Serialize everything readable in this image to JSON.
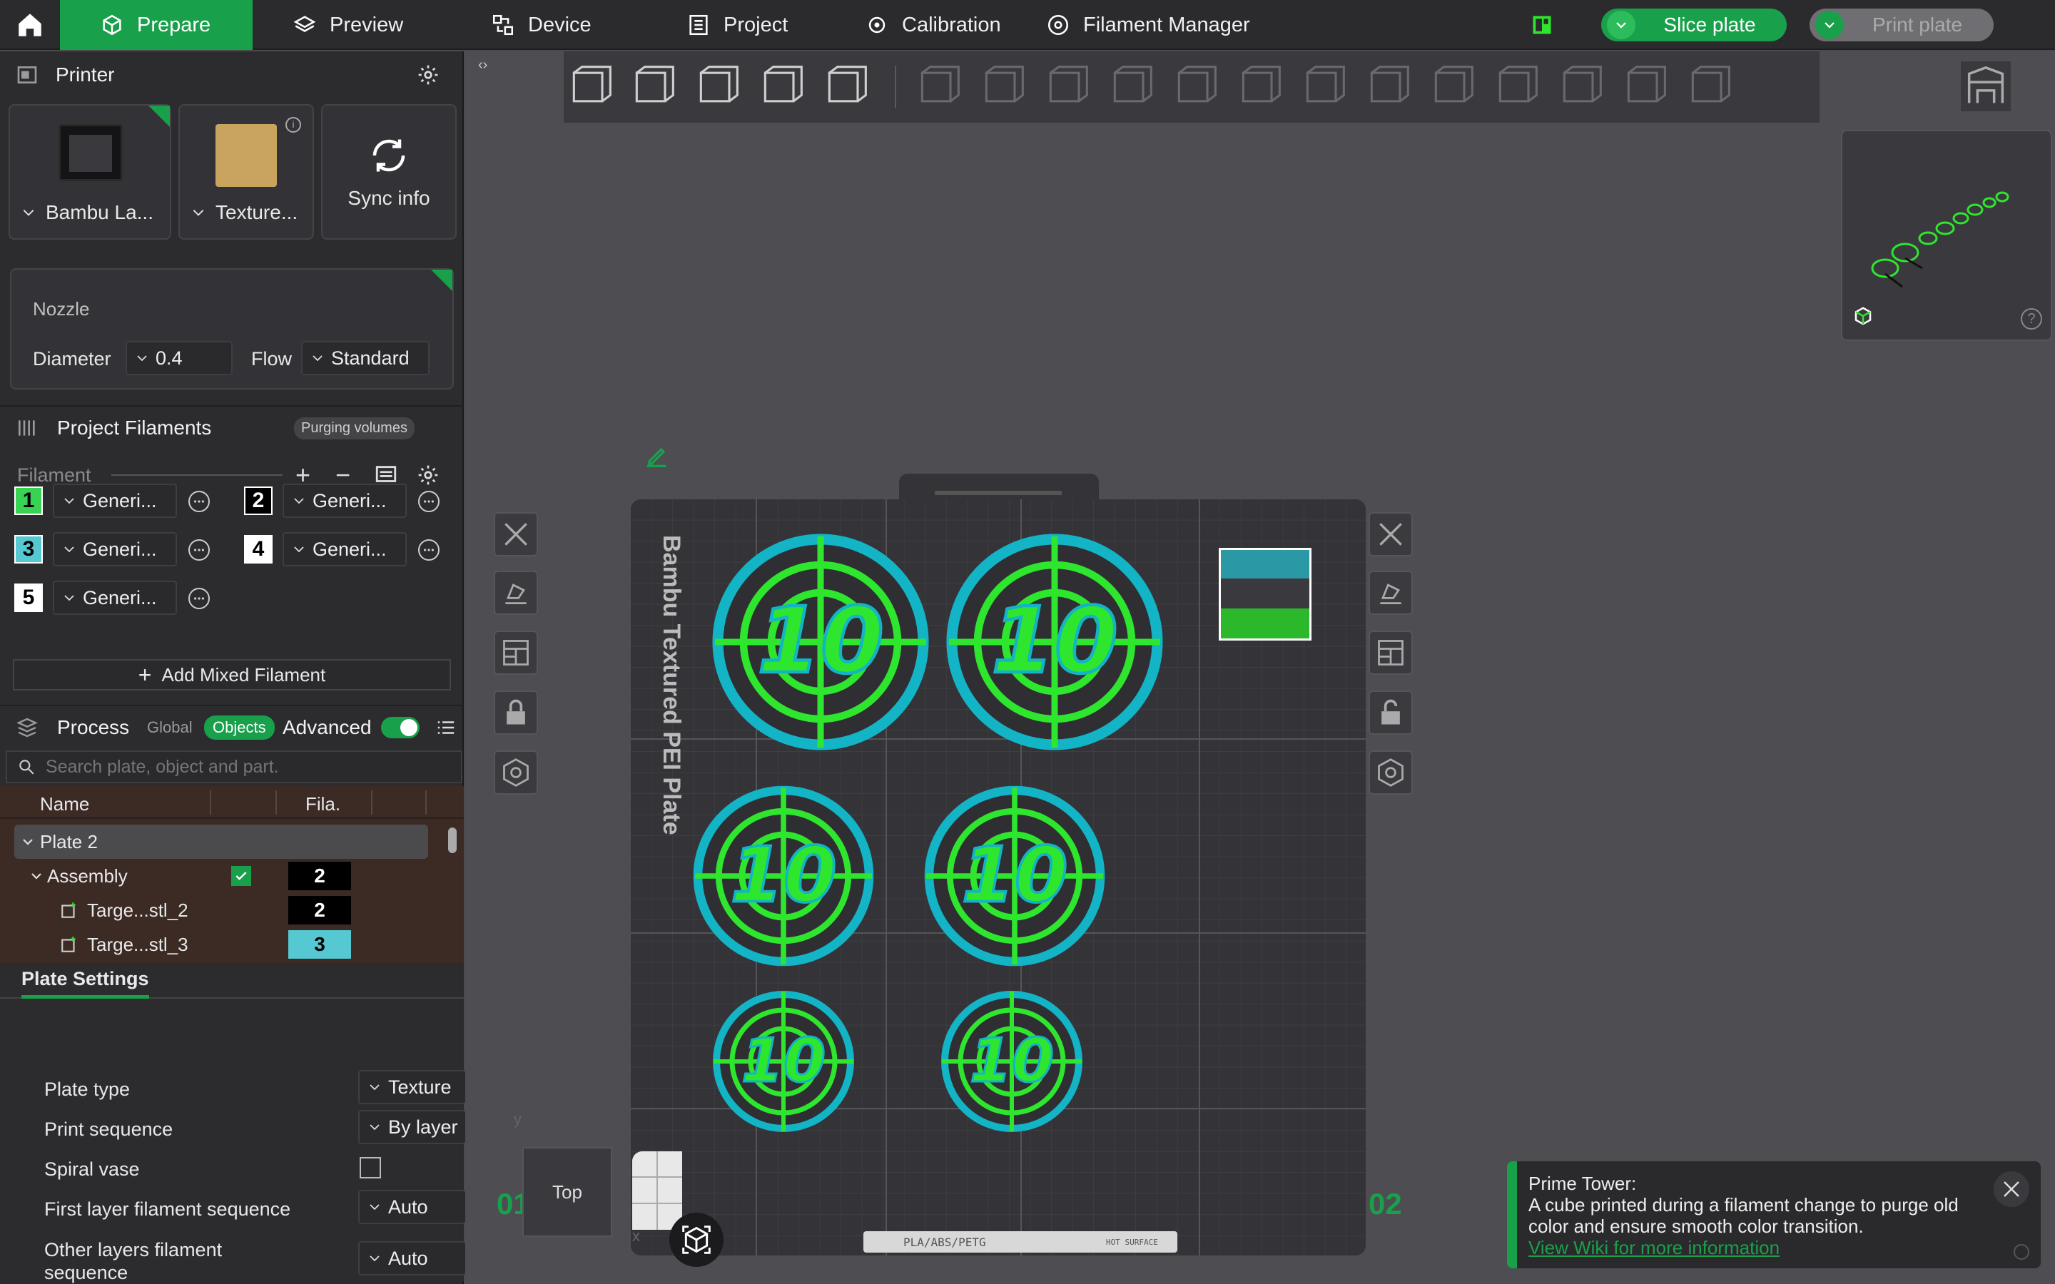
{
  "topbar": {
    "tabs": [
      {
        "label": "Prepare",
        "icon": "cube-icon"
      },
      {
        "label": "Preview",
        "icon": "layers-icon"
      },
      {
        "label": "Device",
        "icon": "device-icon"
      },
      {
        "label": "Project",
        "icon": "project-icon"
      },
      {
        "label": "Calibration",
        "icon": "calibration-icon"
      },
      {
        "label": "Filament Manager",
        "icon": "filament-manager-icon"
      }
    ],
    "slice_label": "Slice plate",
    "print_label": "Print plate"
  },
  "printer": {
    "title": "Printer",
    "printer_name": "Bambu La...",
    "plate_name": "Texture...",
    "sync_label": "Sync info",
    "nozzle_title": "Nozzle",
    "diameter_label": "Diameter",
    "diameter_value": "0.4",
    "flow_label": "Flow",
    "flow_value": "Standard"
  },
  "filaments": {
    "title": "Project Filaments",
    "purge_label": "Purging volumes",
    "filament_label": "Filament",
    "items": [
      {
        "num": "1",
        "name": "Generi...",
        "color": "#39d353",
        "text": "#000"
      },
      {
        "num": "2",
        "name": "Generi...",
        "color": "#000000",
        "text": "#fff"
      },
      {
        "num": "3",
        "name": "Generi...",
        "color": "#55c8d2",
        "text": "#000"
      },
      {
        "num": "4",
        "name": "Generi...",
        "color": "#ffffff",
        "text": "#000"
      },
      {
        "num": "5",
        "name": "Generi...",
        "color": "#ffffff",
        "text": "#000"
      }
    ],
    "add_mixed": "Add Mixed Filament"
  },
  "process": {
    "title": "Process",
    "global_label": "Global",
    "objects_label": "Objects",
    "advanced_label": "Advanced",
    "search_placeholder": "Search plate, object and part.",
    "col_name": "Name",
    "col_fila": "Fila.",
    "tree": [
      {
        "label": "Plate 2",
        "level": 0
      },
      {
        "label": "Assembly",
        "level": 1,
        "fila": "2"
      },
      {
        "label": "Targe...stl_2",
        "level": 2,
        "fila": "2"
      },
      {
        "label": "Targe...stl_3",
        "level": 2,
        "fila": "3"
      }
    ]
  },
  "plate_settings": {
    "title": "Plate Settings",
    "rows": [
      {
        "label": "Plate type",
        "value": "Texture"
      },
      {
        "label": "Print sequence",
        "value": "By layer"
      },
      {
        "label": "Spiral vase",
        "value": ""
      },
      {
        "label": "First layer filament sequence",
        "value": "Auto"
      },
      {
        "label": "Other layers filament sequence",
        "value": "Auto"
      }
    ]
  },
  "viewport": {
    "plate_label": "Bambu Textured PEI Plate",
    "plate_left_num": "01",
    "plate_right_num": "02",
    "view_label": "Top",
    "plate_footer": "PLA/ABS/PETG",
    "plate_footer_hot": "HOT SURFACE",
    "target_text": "10",
    "axis_y": "y",
    "axis_x": "x"
  },
  "toast": {
    "title": "Prime Tower:",
    "body": "A cube printed during a filament change to purge old color and ensure smooth color transition.",
    "link": "View Wiki for more information"
  },
  "colors": {
    "accent": "#19a04b",
    "cyan": "#12b4c6",
    "green": "#2ee62e"
  }
}
